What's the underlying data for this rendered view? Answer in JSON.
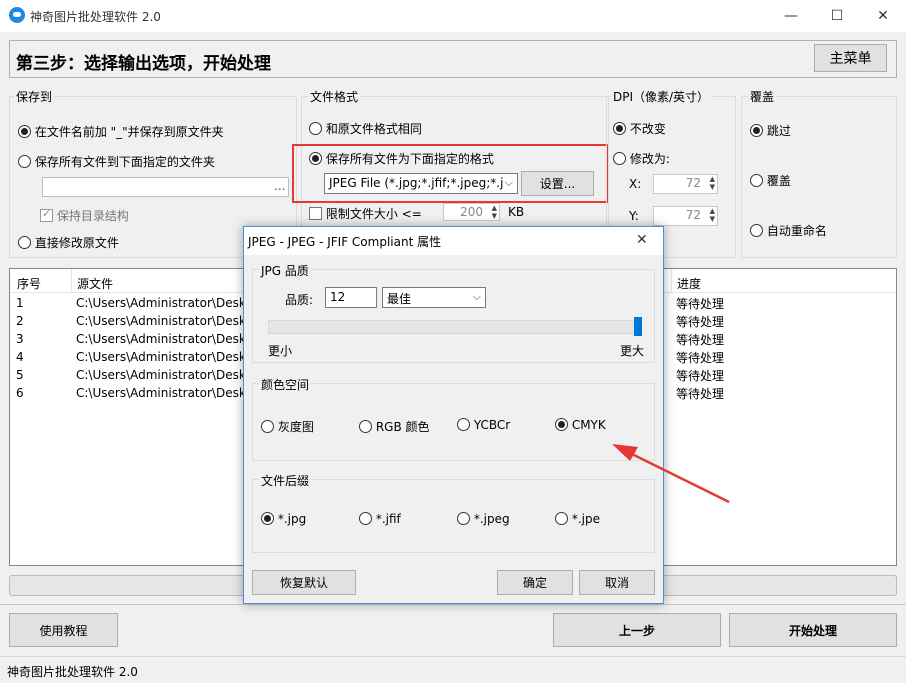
{
  "window": {
    "title": "神奇图片批处理软件 2.0",
    "minimize": "—",
    "maximize": "☐",
    "close": "✕"
  },
  "header": {
    "step_title": "第三步：选择输出选项，开始处理",
    "main_menu": "主菜单"
  },
  "save_to": {
    "title": "保存到",
    "opt_prefix": "在文件名前加 \"_\"并保存到原文件夹",
    "opt_folder": "保存所有文件到下面指定的文件夹",
    "folder_value": "",
    "browse": "...",
    "keep_structure": "保持目录结构",
    "opt_overwrite": "直接修改原文件"
  },
  "file_format": {
    "title": "文件格式",
    "opt_same": "和原文件格式相同",
    "opt_specified": "保存所有文件为下面指定的格式",
    "format_value": "JPEG File (*.jpg;*.jfif;*.jpeg;*.j",
    "settings": "设置...",
    "limit_size": "限制文件大小 <=",
    "limit_value": "200",
    "limit_unit": "KB"
  },
  "dpi": {
    "title": "DPI（像素/英寸）",
    "opt_keep": "不改变",
    "opt_change": "修改为:",
    "x_label": "X:",
    "x_value": "72",
    "y_label": "Y:",
    "y_value": "72"
  },
  "overwrite": {
    "title": "覆盖",
    "opt_skip": "跳过",
    "opt_replace": "覆盖",
    "opt_rename": "自动重命名"
  },
  "file_table": {
    "col_index": "序号",
    "col_source": "源文件",
    "col_progress": "进度",
    "rows": [
      {
        "index": "1",
        "source": "C:\\Users\\Administrator\\Deskto",
        "progress": "等待处理"
      },
      {
        "index": "2",
        "source": "C:\\Users\\Administrator\\Deskto",
        "progress": "等待处理"
      },
      {
        "index": "3",
        "source": "C:\\Users\\Administrator\\Deskto",
        "progress": "等待处理"
      },
      {
        "index": "4",
        "source": "C:\\Users\\Administrator\\Deskto",
        "progress": "等待处理"
      },
      {
        "index": "5",
        "source": "C:\\Users\\Administrator\\Deskto",
        "progress": "等待处理"
      },
      {
        "index": "6",
        "source": "C:\\Users\\Administrator\\Deskto",
        "progress": "等待处理"
      }
    ]
  },
  "footer": {
    "tutorial": "使用教程",
    "prev": "上一步",
    "start": "开始处理",
    "status": "神奇图片批处理软件 2.0"
  },
  "dialog": {
    "title": "JPEG - JPEG - JFIF Compliant 属性",
    "close": "✕",
    "quality_group": "JPG 品质",
    "quality_label": "品质:",
    "quality_value": "12",
    "quality_preset": "最佳",
    "slider_min_label": "更小",
    "slider_max_label": "更大",
    "slider_level": 1.0,
    "color_group": "颜色空间",
    "color_options": [
      "灰度图",
      "RGB 颜色",
      "YCBCr",
      "CMYK"
    ],
    "color_selected": "CMYK",
    "ext_group": "文件后缀",
    "ext_options": [
      "*.jpg",
      "*.jfif",
      "*.jpeg",
      "*.jpe"
    ],
    "ext_selected": "*.jpg",
    "reset": "恢复默认",
    "ok": "确定",
    "cancel": "取消"
  },
  "colors": {
    "highlight_box": "#e53935",
    "arrow": "#e53935",
    "slider_thumb": "#0078d7",
    "dialog_border": "#4a90d9"
  }
}
